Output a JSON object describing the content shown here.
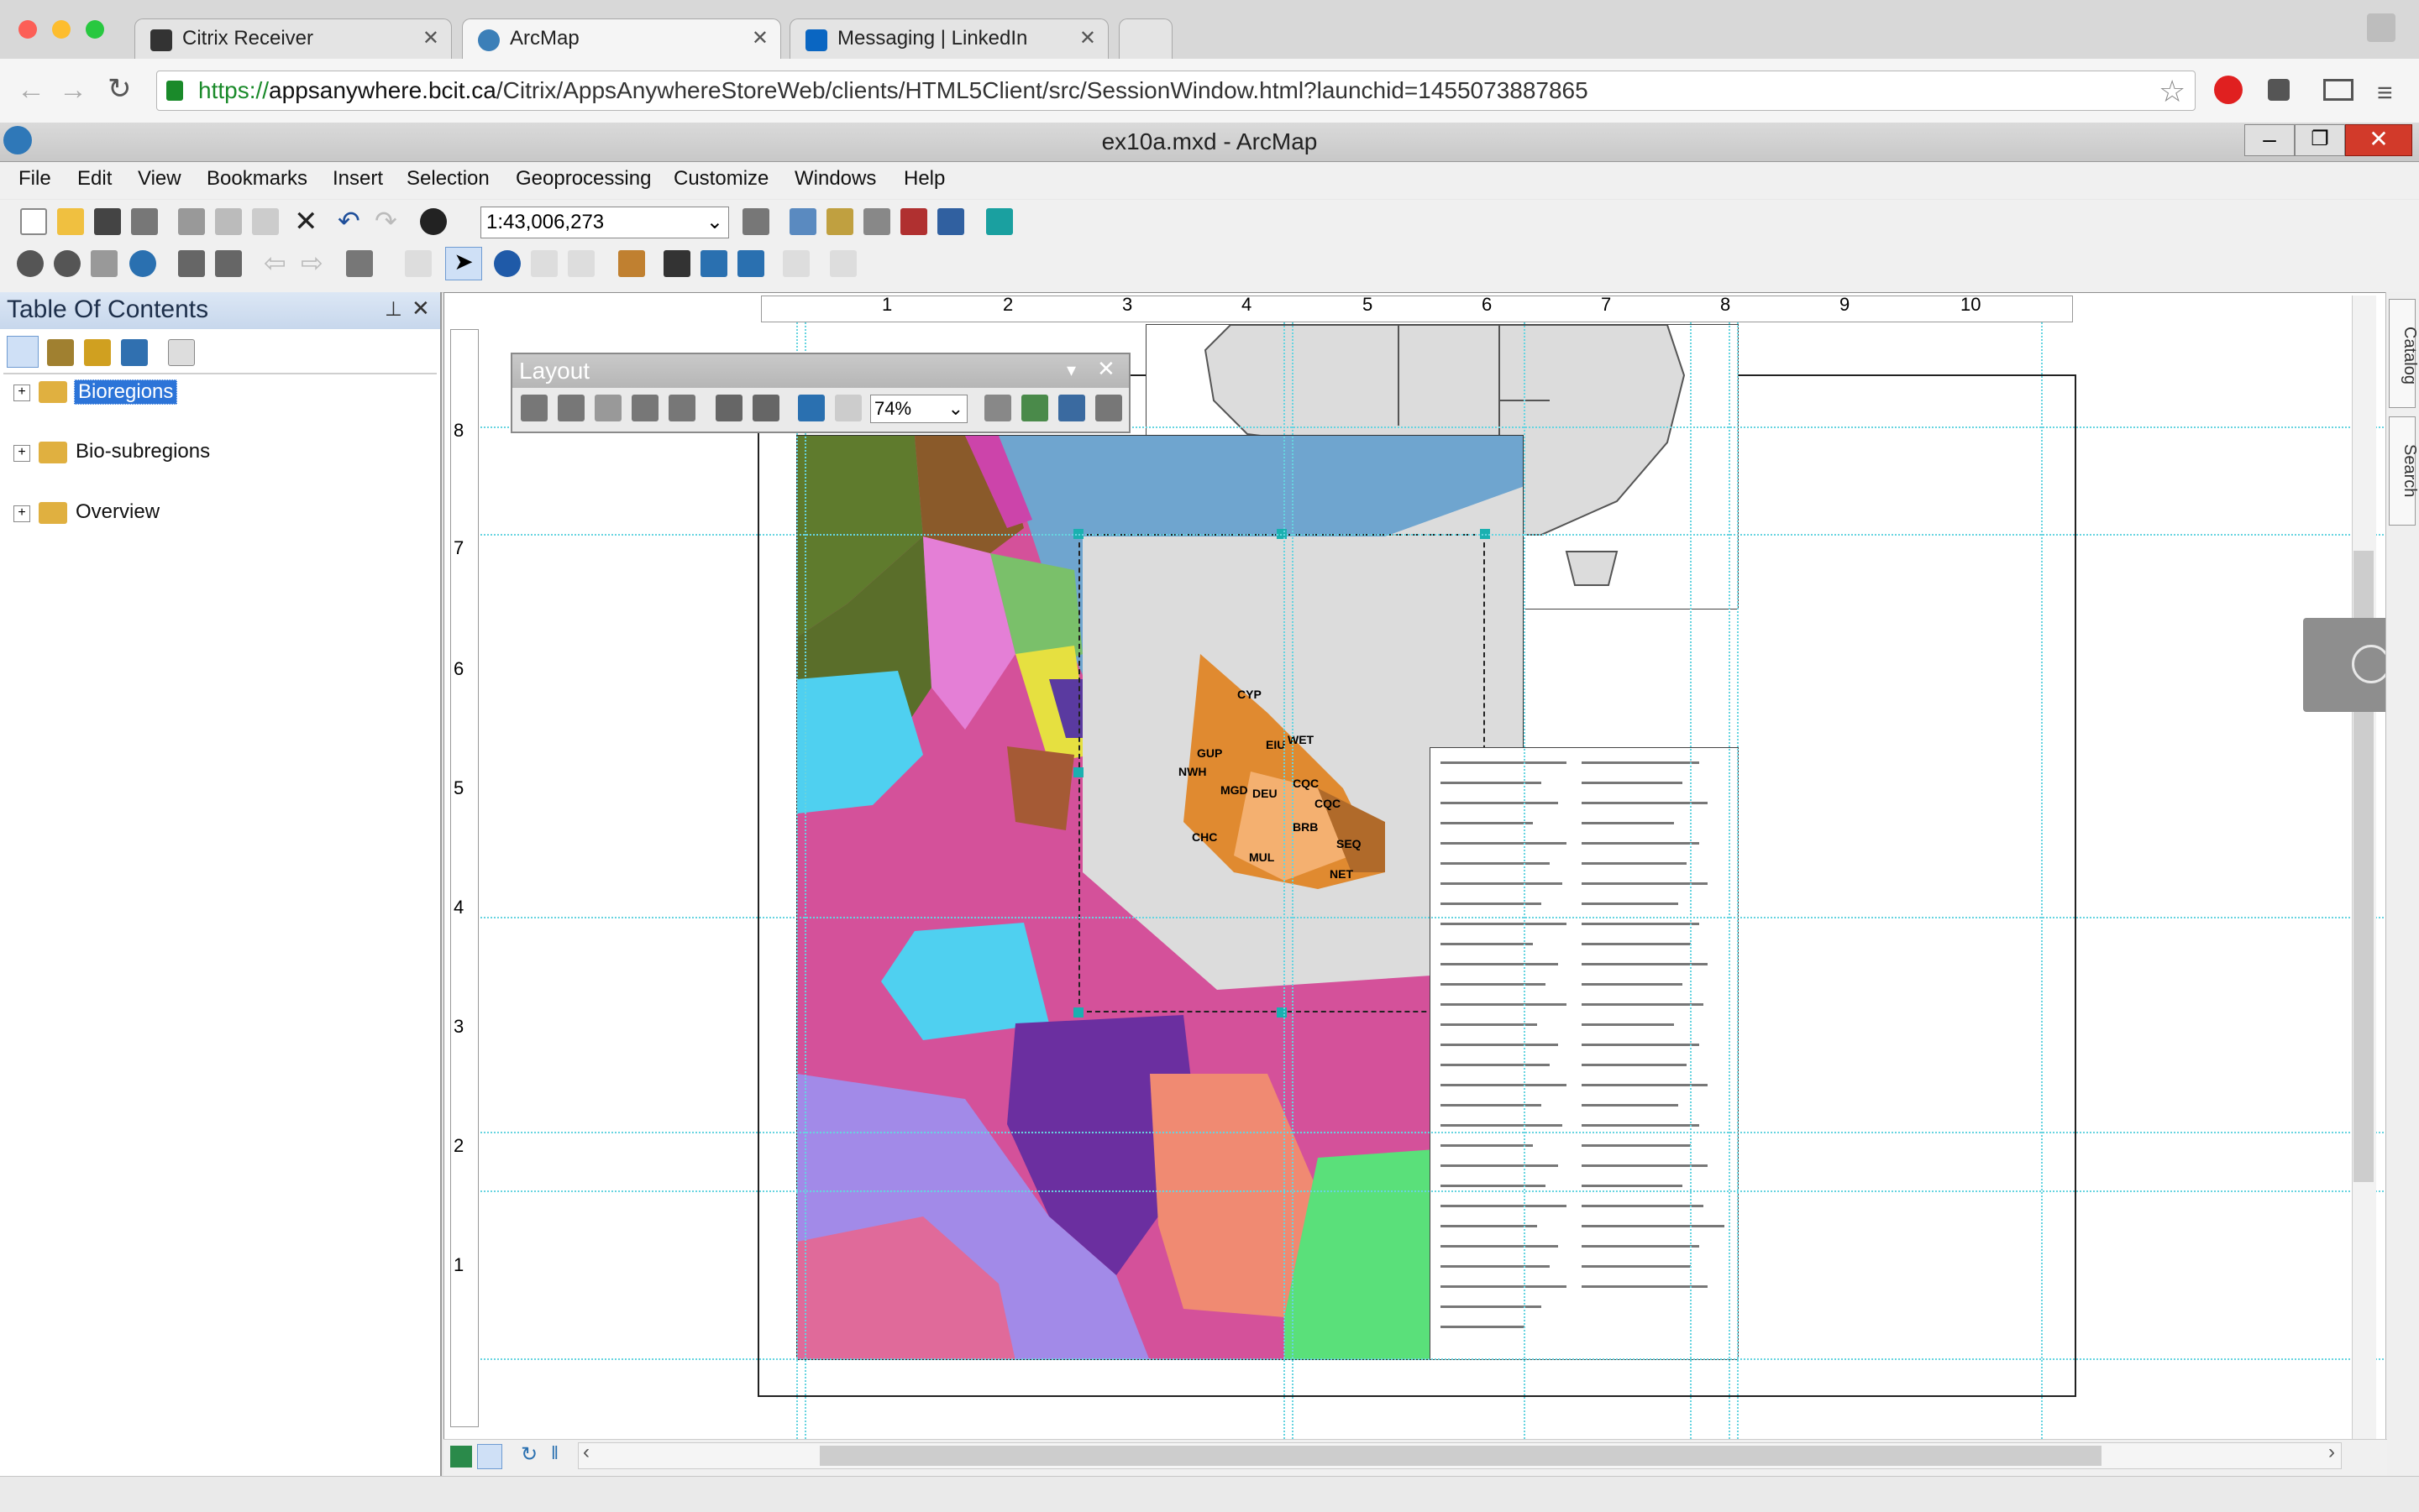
{
  "browser": {
    "tabs": [
      {
        "label": "Citrix Receiver",
        "icon": "citrix-icon"
      },
      {
        "label": "ArcMap",
        "icon": "arcmap-icon"
      },
      {
        "label": "Messaging | LinkedIn",
        "icon": "linkedin-icon"
      }
    ],
    "url_scheme": "https://",
    "url_host": "appsanywhere.bcit.ca",
    "url_path": "/Citrix/AppsAnywhereStoreWeb/clients/HTML5Client/src/SessionWindow.html?launchid=1455073887865"
  },
  "window": {
    "title": "ex10a.mxd - ArcMap"
  },
  "menu": [
    "File",
    "Edit",
    "View",
    "Bookmarks",
    "Insert",
    "Selection",
    "Geoprocessing",
    "Customize",
    "Windows",
    "Help"
  ],
  "toolbar": {
    "scale_value": "1:43,006,273"
  },
  "toc": {
    "title": "Table Of Contents",
    "layers": [
      {
        "label": "Bioregions"
      },
      {
        "label": "Bio-subregions"
      },
      {
        "label": "Overview"
      }
    ]
  },
  "layout_toolbar": {
    "title": "Layout",
    "zoom": "74%"
  },
  "ruler": {
    "h_ticks": [
      "1",
      "2",
      "3",
      "4",
      "5",
      "6",
      "7",
      "8",
      "9",
      "10"
    ],
    "v_ticks": [
      "8",
      "7",
      "6",
      "5",
      "4",
      "3",
      "2",
      "1"
    ]
  },
  "right_tabs": [
    "Catalog",
    "Search"
  ],
  "map_labels": [
    "CYP",
    "WET",
    "EIU",
    "GUP",
    "NWH",
    "MGD",
    "DEU",
    "CQC",
    "CQC",
    "BRB",
    "CHC",
    "SEQ",
    "MUL",
    "NET"
  ],
  "colors": {
    "water": "#6fa5cf",
    "land": "#dddddd",
    "accent": "#0a64ad"
  }
}
